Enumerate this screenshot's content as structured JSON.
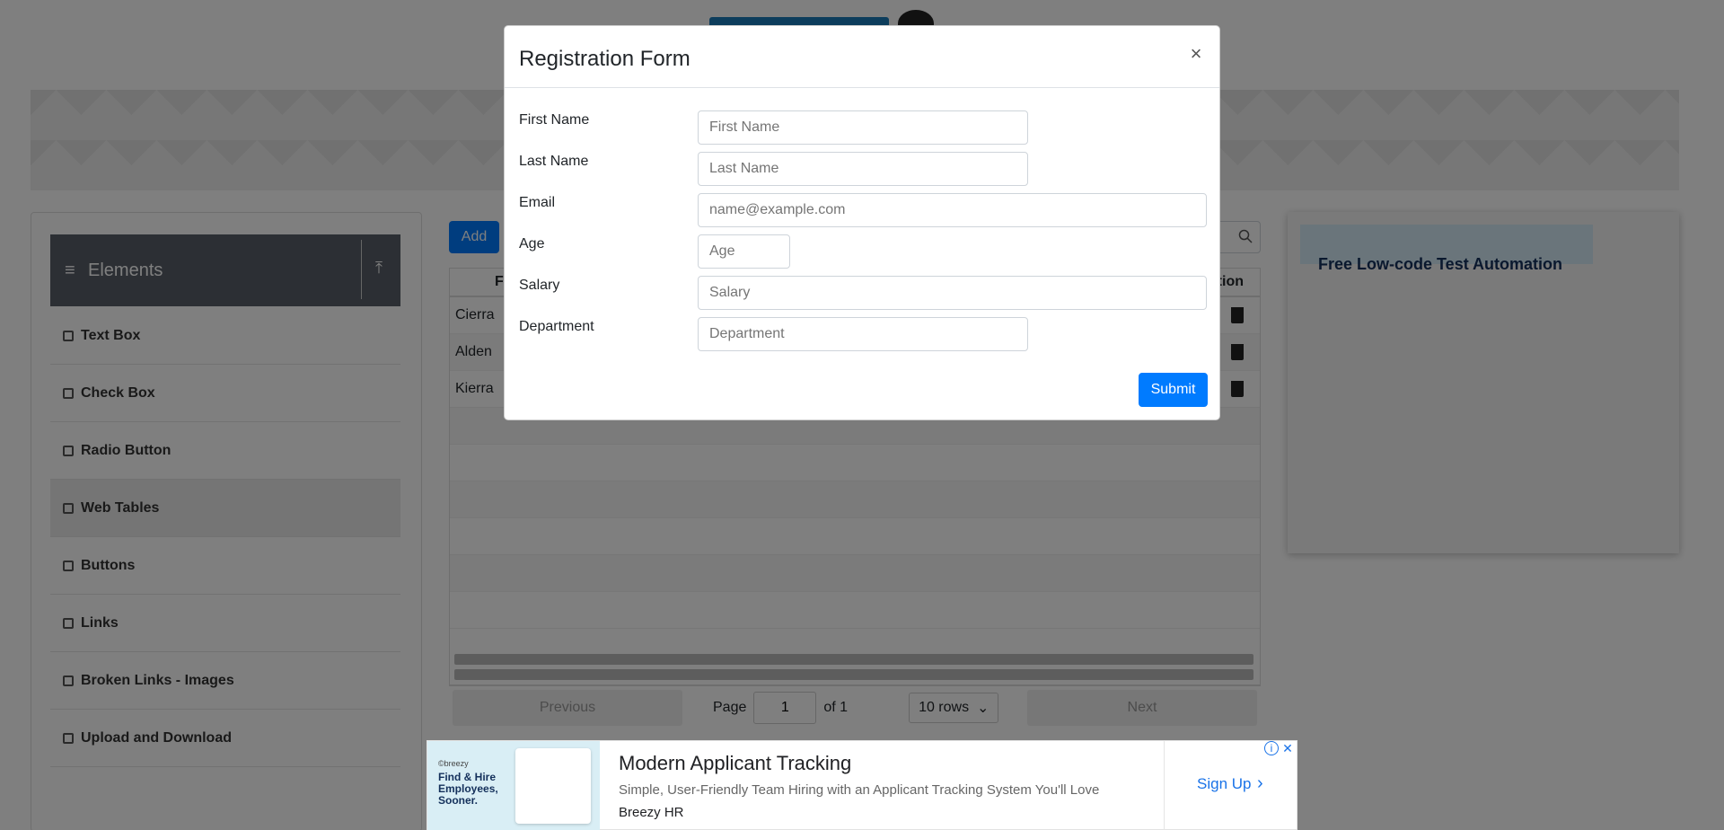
{
  "sidebar": {
    "group_title": "Elements",
    "items": [
      {
        "label": "Text Box"
      },
      {
        "label": "Check Box"
      },
      {
        "label": "Radio Button"
      },
      {
        "label": "Web Tables"
      },
      {
        "label": "Buttons"
      },
      {
        "label": "Links"
      },
      {
        "label": "Broken Links - Images"
      },
      {
        "label": "Upload and Download"
      }
    ]
  },
  "table": {
    "add_label": "Add",
    "header_first": "Fi",
    "header_action": "tion",
    "rows": [
      {
        "first": "Cierra"
      },
      {
        "first": "Alden"
      },
      {
        "first": "Kierra"
      }
    ],
    "pagination": {
      "previous": "Previous",
      "page_label": "Page",
      "page_value": "1",
      "of_label": "of 1",
      "rows_select": "10 rows",
      "next": "Next"
    }
  },
  "right_ad": {
    "text": "Free Low-code Test Automation"
  },
  "bottom_ad": {
    "thumb_brand": "©breezy",
    "thumb_text": "Find & Hire Employees, Sooner.",
    "title": "Modern Applicant Tracking",
    "description": "Simple, User-Friendly Team Hiring with an Applicant Tracking System You'll Love",
    "brand": "Breezy HR",
    "cta": "Sign Up"
  },
  "modal": {
    "title": "Registration Form",
    "close": "×",
    "fields": {
      "first_name": {
        "label": "First Name",
        "placeholder": "First Name"
      },
      "last_name": {
        "label": "Last Name",
        "placeholder": "Last Name"
      },
      "email": {
        "label": "Email",
        "placeholder": "name@example.com"
      },
      "age": {
        "label": "Age",
        "placeholder": "Age"
      },
      "salary": {
        "label": "Salary",
        "placeholder": "Salary"
      },
      "department": {
        "label": "Department",
        "placeholder": "Department"
      }
    },
    "submit_label": "Submit"
  },
  "colors": {
    "primary": "#007bff",
    "sidebar_header": "#585f68",
    "overlay": "rgba(0,0,0,0.5)"
  }
}
